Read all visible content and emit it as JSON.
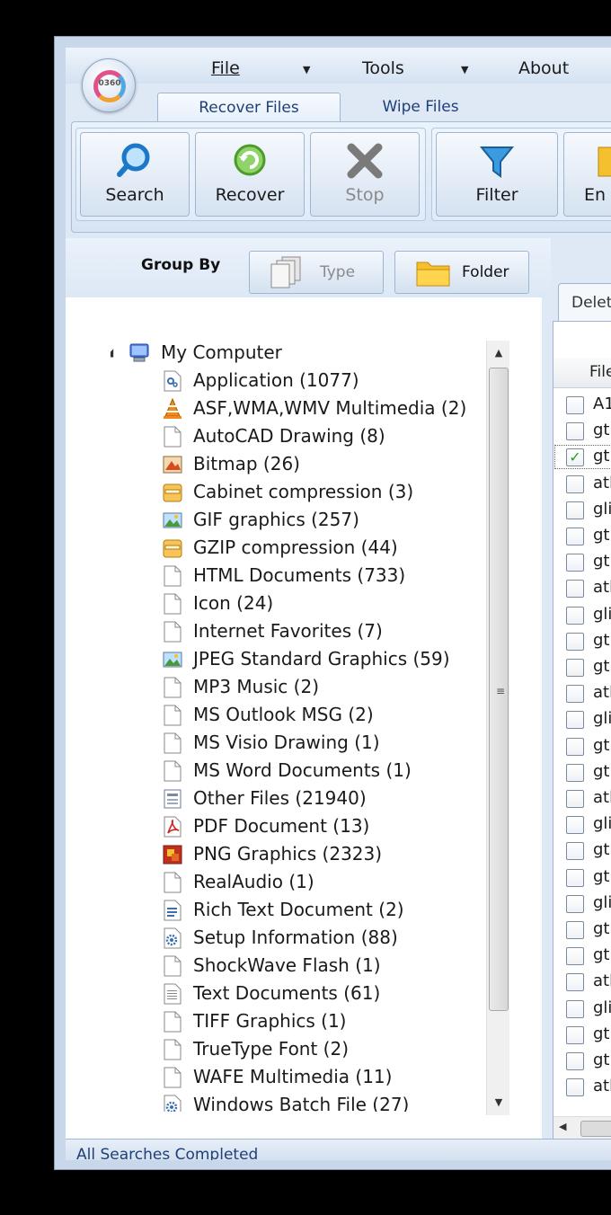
{
  "app": {
    "logo_text": "0360"
  },
  "menu": {
    "file": "File",
    "tools": "Tools",
    "about": "About"
  },
  "tabs": {
    "recover": "Recover Files",
    "wipe": "Wipe Files"
  },
  "ribbon": {
    "search": "Search",
    "recover": "Recover",
    "stop": "Stop",
    "filter": "Filter",
    "next_partial": "En"
  },
  "group_by": {
    "label": "Group By",
    "type": "Type",
    "folder": "Folder"
  },
  "tree": {
    "root": "My Computer",
    "items": [
      {
        "label": "Application (1077)",
        "icon": "application-icon"
      },
      {
        "label": "ASF,WMA,WMV Multimedia (2)",
        "icon": "vlc-cone-icon"
      },
      {
        "label": "AutoCAD Drawing (8)",
        "icon": "blank-file-icon"
      },
      {
        "label": "Bitmap (26)",
        "icon": "bitmap-icon"
      },
      {
        "label": "Cabinet compression (3)",
        "icon": "archive-icon"
      },
      {
        "label": "GIF graphics (257)",
        "icon": "image-icon"
      },
      {
        "label": "GZIP compression (44)",
        "icon": "archive-icon"
      },
      {
        "label": "HTML Documents (733)",
        "icon": "blank-file-icon"
      },
      {
        "label": "Icon (24)",
        "icon": "blank-file-icon"
      },
      {
        "label": "Internet Favorites (7)",
        "icon": "blank-file-icon"
      },
      {
        "label": "JPEG Standard Graphics (59)",
        "icon": "image-icon"
      },
      {
        "label": "MP3 Music (2)",
        "icon": "blank-file-icon"
      },
      {
        "label": "MS Outlook MSG (2)",
        "icon": "blank-file-icon"
      },
      {
        "label": "MS Visio Drawing (1)",
        "icon": "blank-file-icon"
      },
      {
        "label": "MS Word Documents (1)",
        "icon": "blank-file-icon"
      },
      {
        "label": "Other Files (21940)",
        "icon": "other-file-icon"
      },
      {
        "label": "PDF Document (13)",
        "icon": "pdf-icon"
      },
      {
        "label": "PNG Graphics (2323)",
        "icon": "png-icon"
      },
      {
        "label": "RealAudio (1)",
        "icon": "blank-file-icon"
      },
      {
        "label": "Rich Text Document (2)",
        "icon": "rich-text-icon"
      },
      {
        "label": "Setup Information (88)",
        "icon": "gear-file-icon"
      },
      {
        "label": "ShockWave Flash (1)",
        "icon": "blank-file-icon"
      },
      {
        "label": "Text Documents (61)",
        "icon": "text-file-icon"
      },
      {
        "label": "TIFF Graphics (1)",
        "icon": "blank-file-icon"
      },
      {
        "label": "TrueType Font (2)",
        "icon": "blank-file-icon"
      },
      {
        "label": "WAFE Multimedia (11)",
        "icon": "blank-file-icon"
      },
      {
        "label": "Windows Batch File (27)",
        "icon": "gear-file-icon"
      }
    ]
  },
  "results": {
    "tab": "Delet",
    "column": "File",
    "rows": [
      {
        "name": "A1",
        "checked": false
      },
      {
        "name": "gtk",
        "checked": false
      },
      {
        "name": "gtk",
        "checked": true
      },
      {
        "name": "atk",
        "checked": false
      },
      {
        "name": "glib",
        "checked": false
      },
      {
        "name": "gtk",
        "checked": false
      },
      {
        "name": "gtk",
        "checked": false
      },
      {
        "name": "atk",
        "checked": false
      },
      {
        "name": "glib",
        "checked": false
      },
      {
        "name": "gtk",
        "checked": false
      },
      {
        "name": "gtk",
        "checked": false
      },
      {
        "name": "atk",
        "checked": false
      },
      {
        "name": "glib",
        "checked": false
      },
      {
        "name": "gtk",
        "checked": false
      },
      {
        "name": "gtk",
        "checked": false
      },
      {
        "name": "atk",
        "checked": false
      },
      {
        "name": "glib",
        "checked": false
      },
      {
        "name": "gtk",
        "checked": false
      },
      {
        "name": "gtk",
        "checked": false
      },
      {
        "name": "glib",
        "checked": false
      },
      {
        "name": "gtk",
        "checked": false
      },
      {
        "name": "gtk",
        "checked": false
      },
      {
        "name": "atk",
        "checked": false
      },
      {
        "name": "glib",
        "checked": false
      },
      {
        "name": "gtk",
        "checked": false
      },
      {
        "name": "gtk",
        "checked": false
      },
      {
        "name": "atk",
        "checked": false
      }
    ]
  },
  "status": "All Searches Completed"
}
